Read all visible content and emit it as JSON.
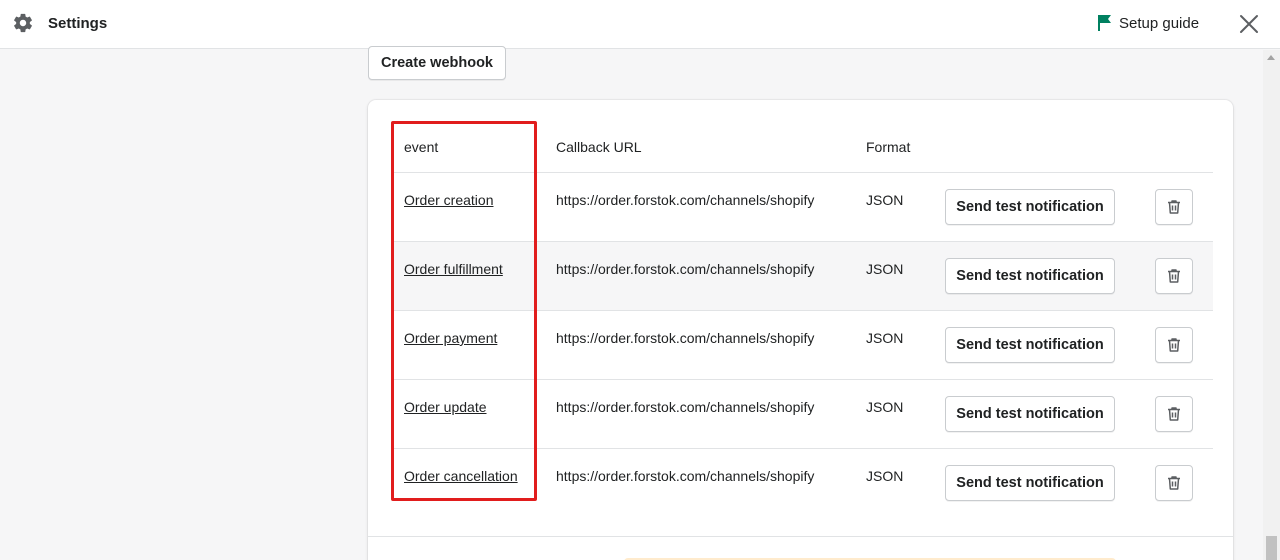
{
  "header": {
    "title": "Settings",
    "setup_guide_label": "Setup guide"
  },
  "actions": {
    "create_webhook_label": "Create webhook"
  },
  "table": {
    "columns": {
      "event": "event",
      "callback_url": "Callback URL",
      "format": "Format"
    },
    "rows": [
      {
        "event": "Order creation",
        "url": "https://order.forstok.com/channels/shopify",
        "format": "JSON",
        "test_label": "Send test notification"
      },
      {
        "event": "Order fulfillment",
        "url": "https://order.forstok.com/channels/shopify",
        "format": "JSON",
        "test_label": "Send test notification"
      },
      {
        "event": "Order payment",
        "url": "https://order.forstok.com/channels/shopify",
        "format": "JSON",
        "test_label": "Send test notification"
      },
      {
        "event": "Order update",
        "url": "https://order.forstok.com/channels/shopify",
        "format": "JSON",
        "test_label": "Send test notification"
      },
      {
        "event": "Order cancellation",
        "url": "https://order.forstok.com/channels/shopify",
        "format": "JSON",
        "test_label": "Send test notification"
      }
    ]
  },
  "icons": {
    "settings": "gear-icon",
    "setup_guide": "flag-icon",
    "close": "close-icon",
    "delete": "trash-icon"
  },
  "colors": {
    "accent": "#008060",
    "highlight": "#e11d1d",
    "banner": "#ffebcd"
  }
}
